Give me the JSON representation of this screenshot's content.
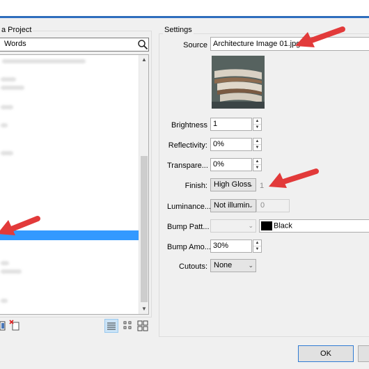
{
  "left_panel": {
    "group_title": "a Project",
    "search": {
      "value": "Words",
      "icon": "search-icon"
    },
    "list_placeholder_first": ", Transparent, Main Image",
    "view_icons": [
      "details-view-icon",
      "small-thumbnails-icon",
      "large-thumbnails-icon"
    ]
  },
  "settings": {
    "group_title": "Settings",
    "source_label": "Source",
    "source_value": "Architecture Image 01.jpg",
    "brightness_label": "Brightness",
    "brightness_value": "1",
    "reflectivity_label": "Reflectivity:",
    "reflectivity_value": "0%",
    "transparency_label": "Transpare...",
    "transparency_value": "0%",
    "finish_label": "Finish:",
    "finish_value": "High Gloss",
    "finish_level": "1",
    "luminance_label": "Luminance...",
    "luminance_value": "Not illumin",
    "luminance_level": "0",
    "bump_pattern_label": "Bump Patt...",
    "bump_pattern_value": "",
    "bump_color_value": "Black",
    "bump_amount_label": "Bump Amo...",
    "bump_amount_value": "30%",
    "cutouts_label": "Cutouts:",
    "cutouts_value": "None"
  },
  "footer": {
    "ok_label": "OK"
  },
  "colors": {
    "accent": "#3399ff",
    "arrow": "#e23a3a",
    "selection": "#3399ff"
  }
}
